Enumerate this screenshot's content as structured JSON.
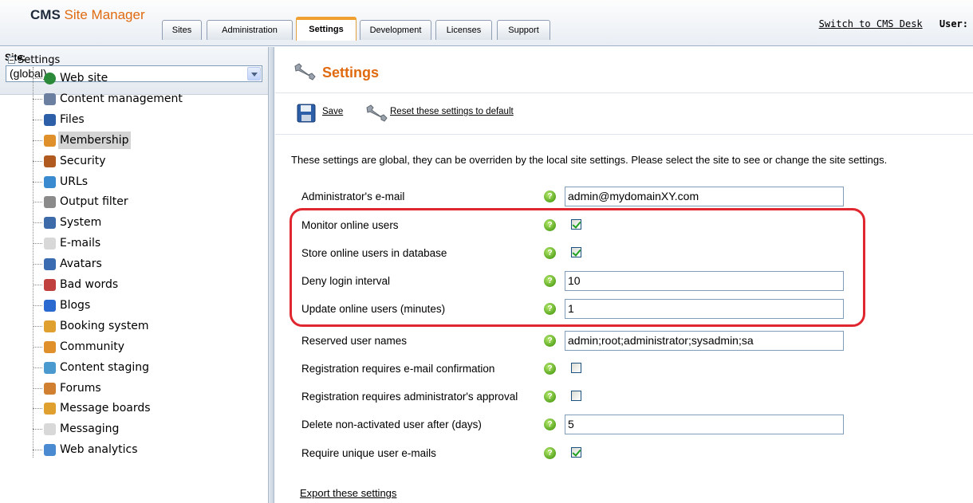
{
  "header": {
    "logo_cms": "CMS",
    "logo_site_manager": "Site Manager",
    "tabs": [
      {
        "label": "Sites"
      },
      {
        "label": "Administration"
      },
      {
        "label": "Settings"
      },
      {
        "label": "Development"
      },
      {
        "label": "Licenses"
      },
      {
        "label": "Support"
      }
    ],
    "active_tab": "Settings",
    "switch_link": "Switch to CMS Desk",
    "user_label": "User:"
  },
  "sidebar": {
    "site_label": "Site:",
    "site_value": "(global)",
    "tree_root": "Settings",
    "items": [
      {
        "label": "Web site",
        "icon": "globe-icon"
      },
      {
        "label": "Content management",
        "icon": "content-management-icon"
      },
      {
        "label": "Files",
        "icon": "floppy-icon"
      },
      {
        "label": "Membership",
        "icon": "user-icon"
      },
      {
        "label": "Security",
        "icon": "security-icon"
      },
      {
        "label": "URLs",
        "icon": "urls-icon"
      },
      {
        "label": "Output filter",
        "icon": "filter-icon"
      },
      {
        "label": "System",
        "icon": "computer-icon"
      },
      {
        "label": "E-mails",
        "icon": "envelope-icon"
      },
      {
        "label": "Avatars",
        "icon": "avatar-icon"
      },
      {
        "label": "Bad words",
        "icon": "bad-words-icon"
      },
      {
        "label": "Blogs",
        "icon": "blog-icon"
      },
      {
        "label": "Booking system",
        "icon": "booking-icon"
      },
      {
        "label": "Community",
        "icon": "community-icon"
      },
      {
        "label": "Content staging",
        "icon": "staging-icon"
      },
      {
        "label": "Forums",
        "icon": "forums-icon"
      },
      {
        "label": "Message boards",
        "icon": "message-board-icon"
      },
      {
        "label": "Messaging",
        "icon": "messaging-icon"
      },
      {
        "label": "Web analytics",
        "icon": "analytics-icon"
      }
    ],
    "selected_item": "Membership"
  },
  "main": {
    "title": "Settings",
    "save_label": "Save",
    "reset_label": "Reset these settings to default",
    "info_text": "These settings are global, they can be overriden by the local site settings. Please select the site to see or change the site settings.",
    "settings": [
      {
        "label": "Administrator's e-mail",
        "type": "text",
        "value": "admin@mydomainXY.com"
      },
      {
        "label": "Monitor online users",
        "type": "checkbox",
        "checked": true
      },
      {
        "label": "Store online users in database",
        "type": "checkbox",
        "checked": true
      },
      {
        "label": "Deny login interval",
        "type": "text",
        "value": "10"
      },
      {
        "label": "Update online users (minutes)",
        "type": "text",
        "value": "1"
      },
      {
        "label": "Reserved user names",
        "type": "text",
        "value": "admin;root;administrator;sysadmin;sa"
      },
      {
        "label": "Registration requires e-mail confirmation",
        "type": "checkbox",
        "checked": false
      },
      {
        "label": "Registration requires administrator's approval",
        "type": "checkbox",
        "checked": false
      },
      {
        "label": "Delete non-activated user after (days)",
        "type": "text",
        "value": "5"
      },
      {
        "label": "Require unique user e-mails",
        "type": "checkbox",
        "checked": true
      }
    ],
    "help_glyph": "?",
    "export_label": "Export these settings"
  },
  "colors": {
    "accent_orange": "#e06a10",
    "highlight_red": "#e0262e",
    "help_green": "#5aa820"
  }
}
